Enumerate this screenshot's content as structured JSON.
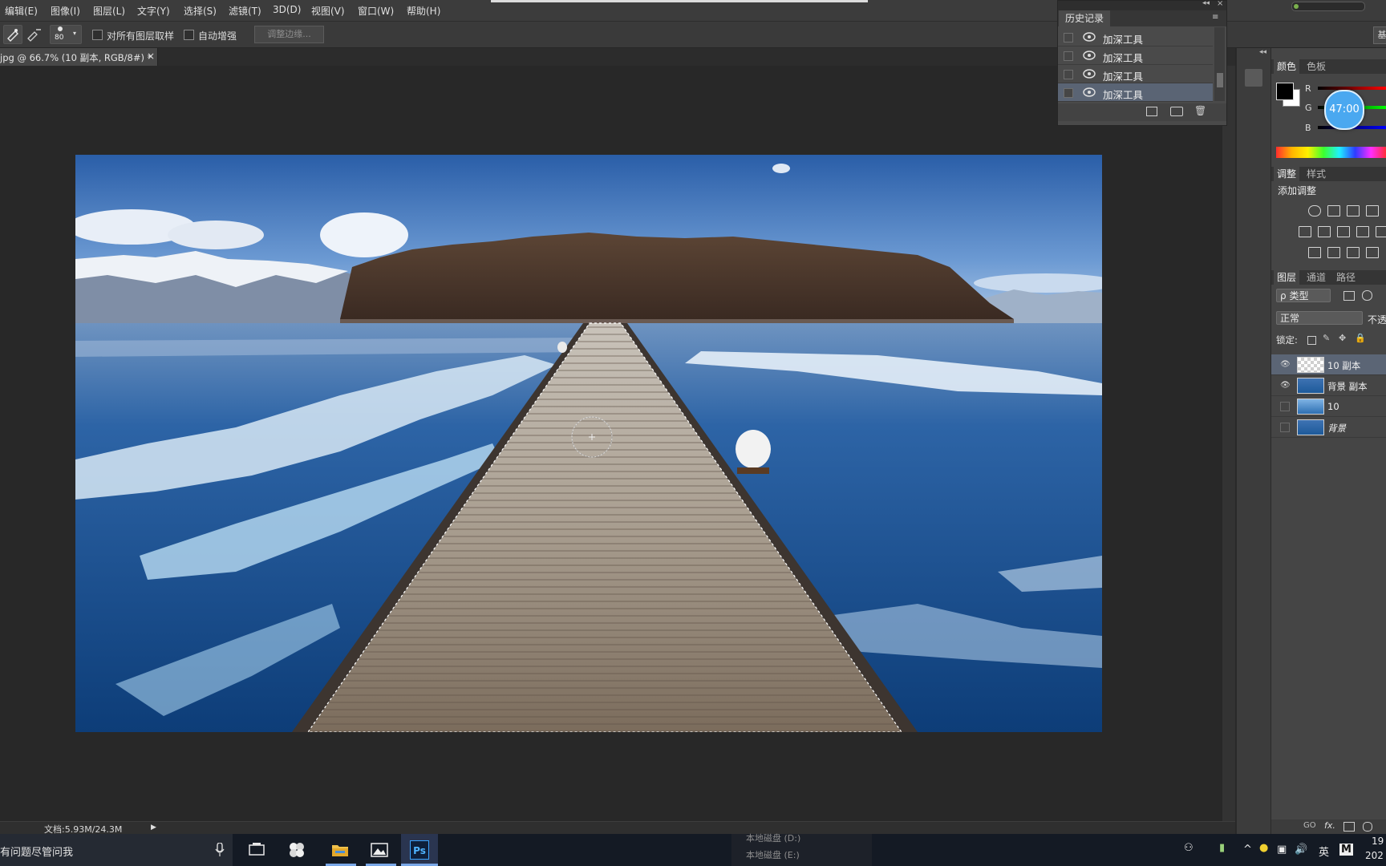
{
  "menu": [
    "编辑(E)",
    "图像(I)",
    "图层(L)",
    "文字(Y)",
    "选择(S)",
    "滤镜(T)",
    "3D(D)",
    "视图(V)",
    "窗口(W)",
    "帮助(H)"
  ],
  "options": {
    "brush_size": "80",
    "sample_all_layers": "对所有图层取样",
    "auto_enhance": "自动增强",
    "refine_edge": "调整边缘...",
    "workspace": "基"
  },
  "document": {
    "tab_title": "jpg @ 66.7% (10 副本, RGB/8#) *",
    "close": "×",
    "status": "文档:5.93M/24.3M"
  },
  "history": {
    "title": "历史记录",
    "items": [
      "加深工具",
      "加深工具",
      "加深工具",
      "加深工具"
    ],
    "selected_index": 3
  },
  "color_panel": {
    "tabs": [
      "颜色",
      "色板"
    ],
    "channels": [
      "R",
      "G",
      "B"
    ],
    "foreground": "#000000",
    "background": "#ffffff"
  },
  "timer": "47:00",
  "adjust_panel": {
    "tabs": [
      "调整",
      "样式"
    ],
    "heading": "添加调整"
  },
  "layers_panel": {
    "tabs": [
      "图层",
      "通道",
      "路径"
    ],
    "filter": "类型",
    "blend_mode": "正常",
    "opacity_label": "不透",
    "lock_label": "锁定:",
    "layers": [
      {
        "name": "10 副本",
        "visible": true,
        "selected": true
      },
      {
        "name": "背景 副本",
        "visible": true,
        "selected": false
      },
      {
        "name": "10",
        "visible": false,
        "selected": false
      },
      {
        "name": "背景",
        "visible": false,
        "selected": false
      }
    ],
    "footer": [
      "GO",
      "fx."
    ]
  },
  "taskbar": {
    "search_text": "有问题尽管问我",
    "explorer_lines": [
      "本地磁盘 (D:)",
      "本地磁盘 (E:)"
    ],
    "ime": "英",
    "clock_time": "19",
    "clock_date": "202"
  },
  "colors": {
    "accent_blue": "#4aa8f0",
    "selected_row": "#5b6575"
  }
}
